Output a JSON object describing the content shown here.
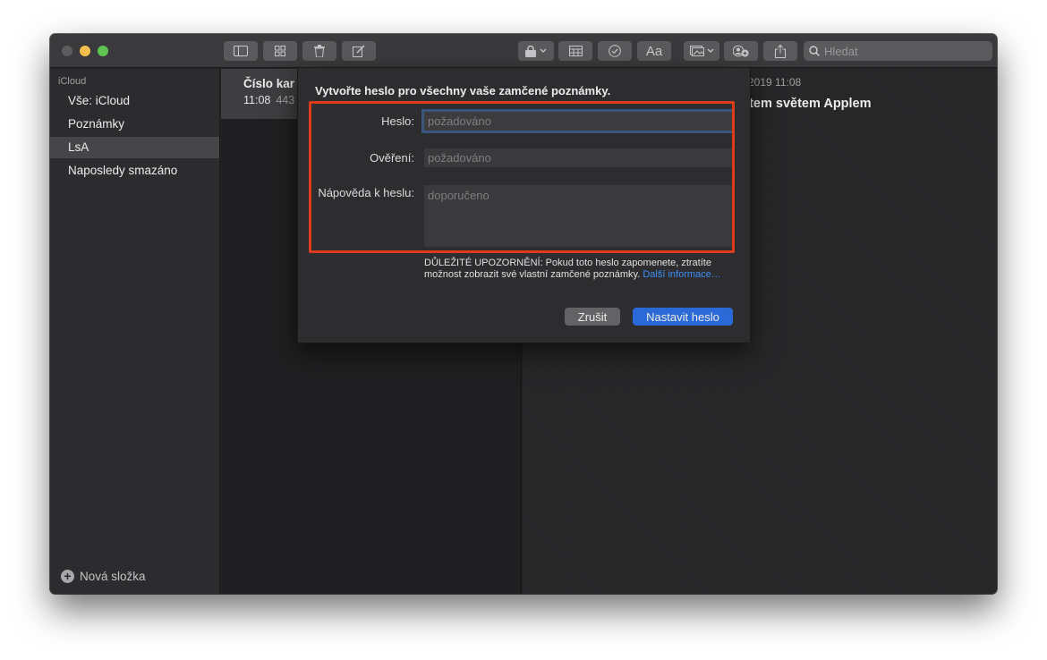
{
  "toolbar": {
    "search_placeholder": "Hledat",
    "buttons": [
      "sidebar-icon",
      "gallery-icon",
      "trash-icon",
      "compose-icon",
      "lock-icon",
      "table-icon",
      "checklist-icon",
      "format-icon",
      "media-icon",
      "share-people-icon",
      "share-icon"
    ],
    "format_label": "Aa"
  },
  "sidebar": {
    "account": "iCloud",
    "items": [
      {
        "label": "Vše: iCloud"
      },
      {
        "label": "Poznámky"
      },
      {
        "label": "LsA",
        "selected": true
      },
      {
        "label": "Naposledy smazáno"
      }
    ],
    "new_folder": "Nová složka"
  },
  "note_list": {
    "item": {
      "title": "Číslo kar",
      "time": "11:08",
      "preview": "443"
    }
  },
  "editor": {
    "date": "a 2019 11:08",
    "title": "etem světem Applem"
  },
  "dialog": {
    "title": "Vytvořte heslo pro všechny vaše zamčené poznámky.",
    "password_label": "Heslo:",
    "password_placeholder": "požadováno",
    "verify_label": "Ověření:",
    "verify_placeholder": "požadováno",
    "hint_label": "Nápověda k heslu:",
    "hint_placeholder": "doporučeno",
    "warning_text": "DŮLEŽITÉ UPOZORNĚNÍ: Pokud toto heslo zapomenete, ztratíte možnost zobrazit své vlastní zamčené poznámky.",
    "warning_link": "Další informace…",
    "cancel_label": "Zrušit",
    "confirm_label": "Nastavit heslo"
  },
  "colors": {
    "highlight": "#e03a1c",
    "primary_button": "#2a69d6",
    "link": "#3d8ff5"
  }
}
